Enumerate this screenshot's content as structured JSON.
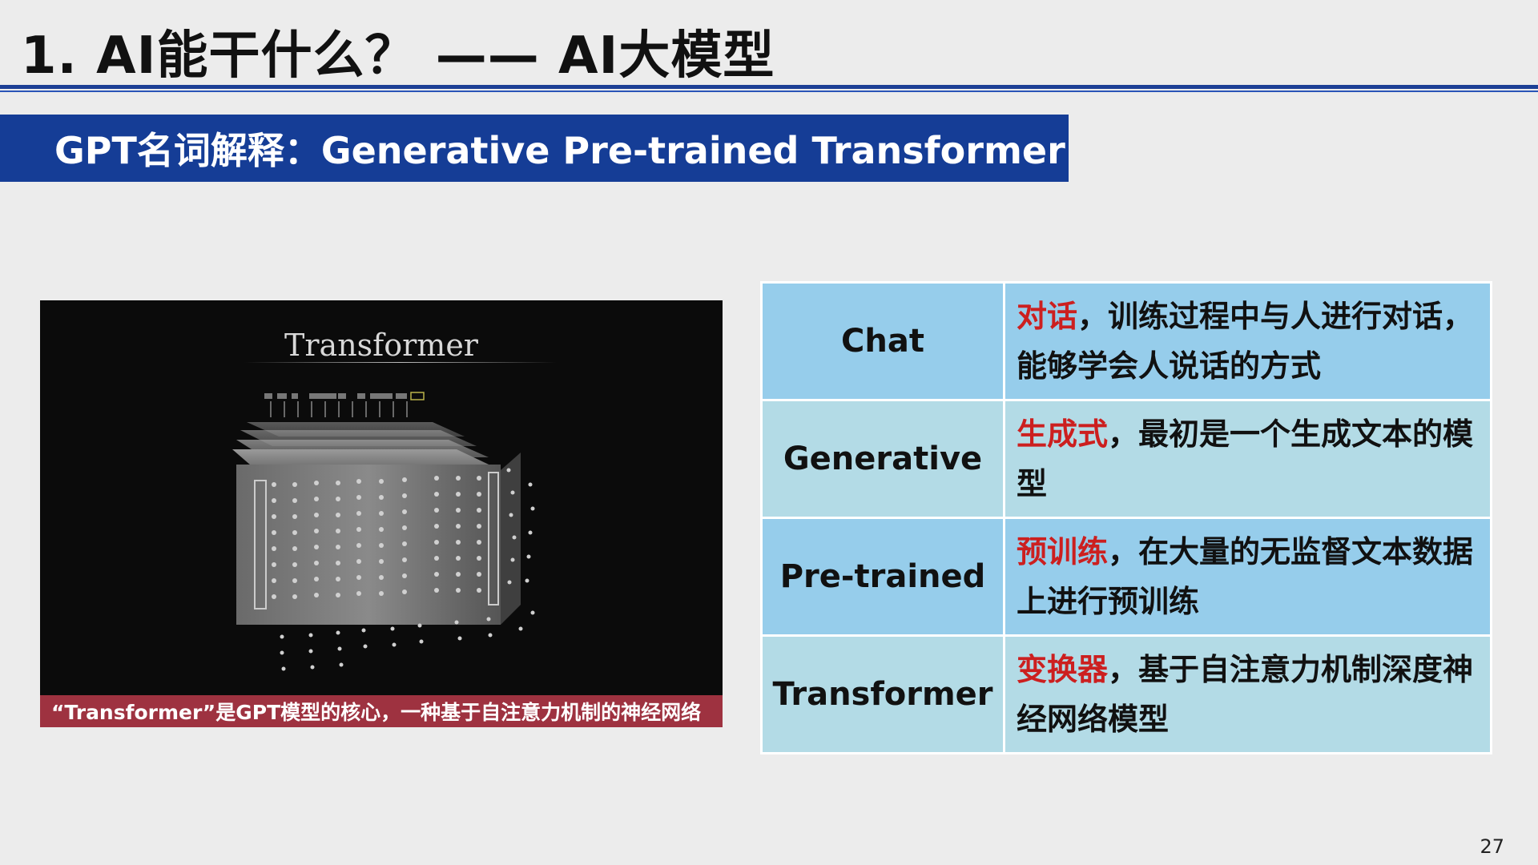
{
  "slide": {
    "title": "1. AI能干什么？ —— AI大模型",
    "banner": "GPT名词解释：Generative Pre-trained Transformer",
    "page_number": "27"
  },
  "video": {
    "title": "Transformer",
    "caption": "“Transformer”是GPT模型的核心，一种基于自注意力机制的神经网络"
  },
  "table": {
    "rows": [
      {
        "term": "Chat",
        "highlight": "对话",
        "text": "，训练过程中与人进行对话，能够学会人说话的方式"
      },
      {
        "term": "Generative",
        "highlight": "生成式",
        "text": "，最初是一个生成文本的模型"
      },
      {
        "term": "Pre-trained",
        "highlight": "预训练",
        "text": "，在大量的无监督文本数据上进行预训练"
      },
      {
        "term": "Transformer",
        "highlight": "变换器",
        "text": "，基于自注意力机制深度神经网络模型"
      }
    ]
  },
  "colors": {
    "banner": "#153d96",
    "title_rule": "#1d3f95",
    "table_blue": "#96cdeb",
    "table_light": "#b3dbe6",
    "highlight_red": "#cc1f1f",
    "caption_bar": "#9e3240"
  }
}
